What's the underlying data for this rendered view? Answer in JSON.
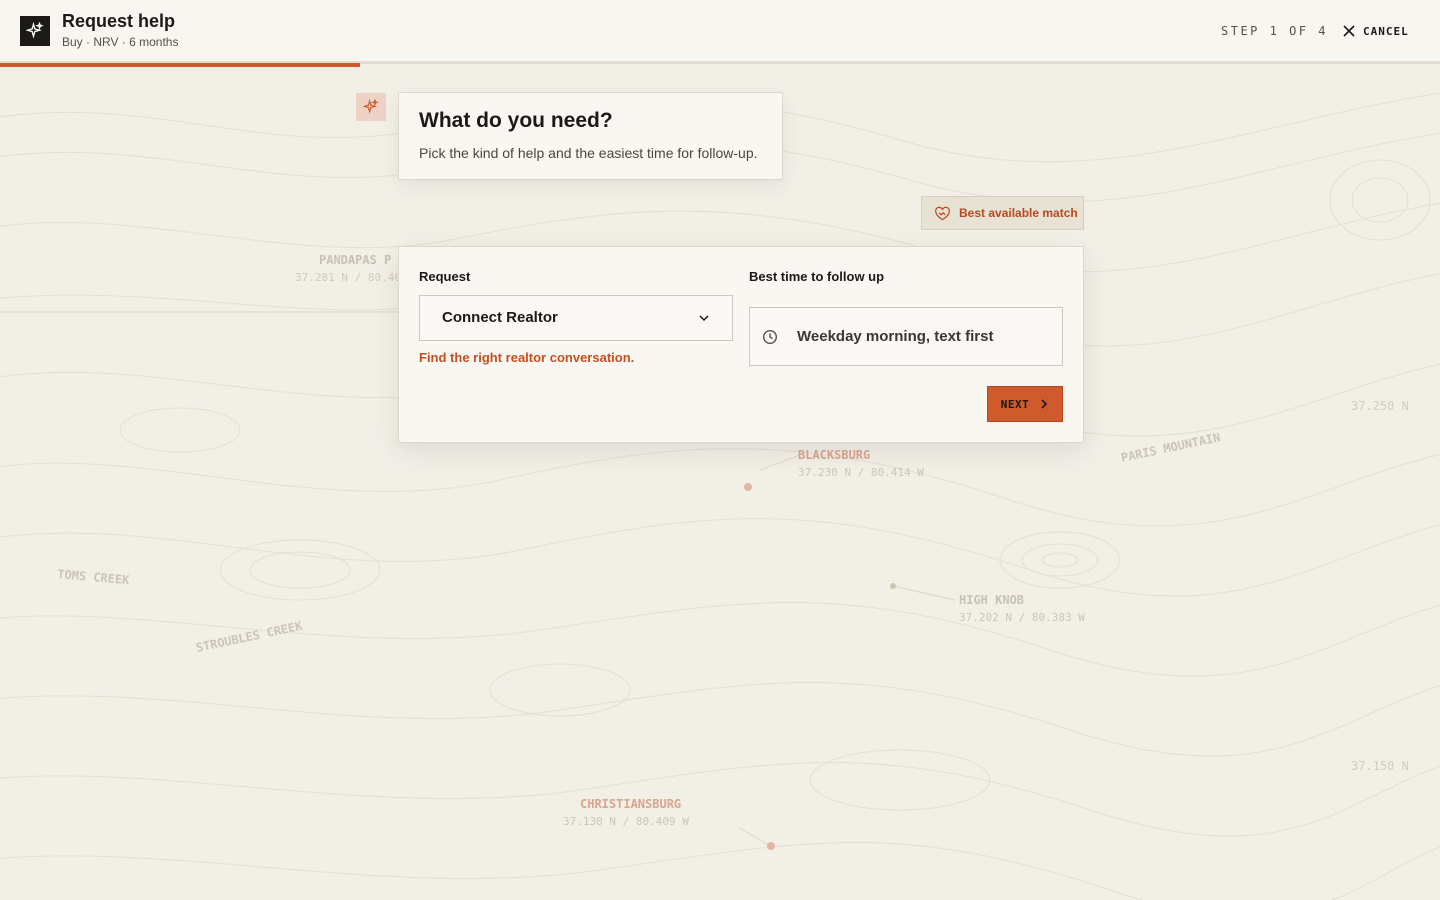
{
  "header": {
    "title": "Request help",
    "subtitle": "Buy · NRV · 6 months",
    "step": "STEP 1 OF 4",
    "cancel_label": "CANCEL",
    "progress_fraction": 0.25
  },
  "question": {
    "title": "What do you need?",
    "description": "Pick the kind of help and the easiest time for follow-up."
  },
  "badge": {
    "label": "Best available match"
  },
  "form": {
    "request_label": "Request",
    "request_value": "Connect Realtor",
    "request_hint": "Find the right realtor conversation.",
    "time_label": "Best time to follow up",
    "time_value": "Weekday morning, text first",
    "next_label": "NEXT"
  },
  "map": {
    "labels": {
      "pandapas": "PANDAPAS P",
      "pandapas_coord": "37.281 N / 80.40",
      "blacksburg": "BLACKSBURG",
      "blacksburg_coord": "37.230 N / 80.414 W",
      "high_knob": "HIGH KNOB",
      "high_knob_coord": "37.202 N / 80.383 W",
      "christiansburg": "CHRISTIANSBURG",
      "christiansburg_coord": "37.130 N / 80.409 W",
      "paris_mountain": "PARIS MOUNTAIN",
      "toms_creek": "TOMS CREEK",
      "stroubles_creek": "STROUBLES CREEK",
      "lat_1": "37.250 N",
      "lat_2": "37.150 N"
    }
  },
  "colors": {
    "accent": "#cf5a2c",
    "background": "#f2efe7",
    "card": "#f9f7f2",
    "text": "#1c1a17"
  },
  "icons": {
    "logo": "sparkle-icon",
    "cancel": "close-icon",
    "badge": "handshake-shield-icon",
    "select": "chevron-down-icon",
    "time": "clock-icon",
    "next": "chevron-right-icon"
  }
}
